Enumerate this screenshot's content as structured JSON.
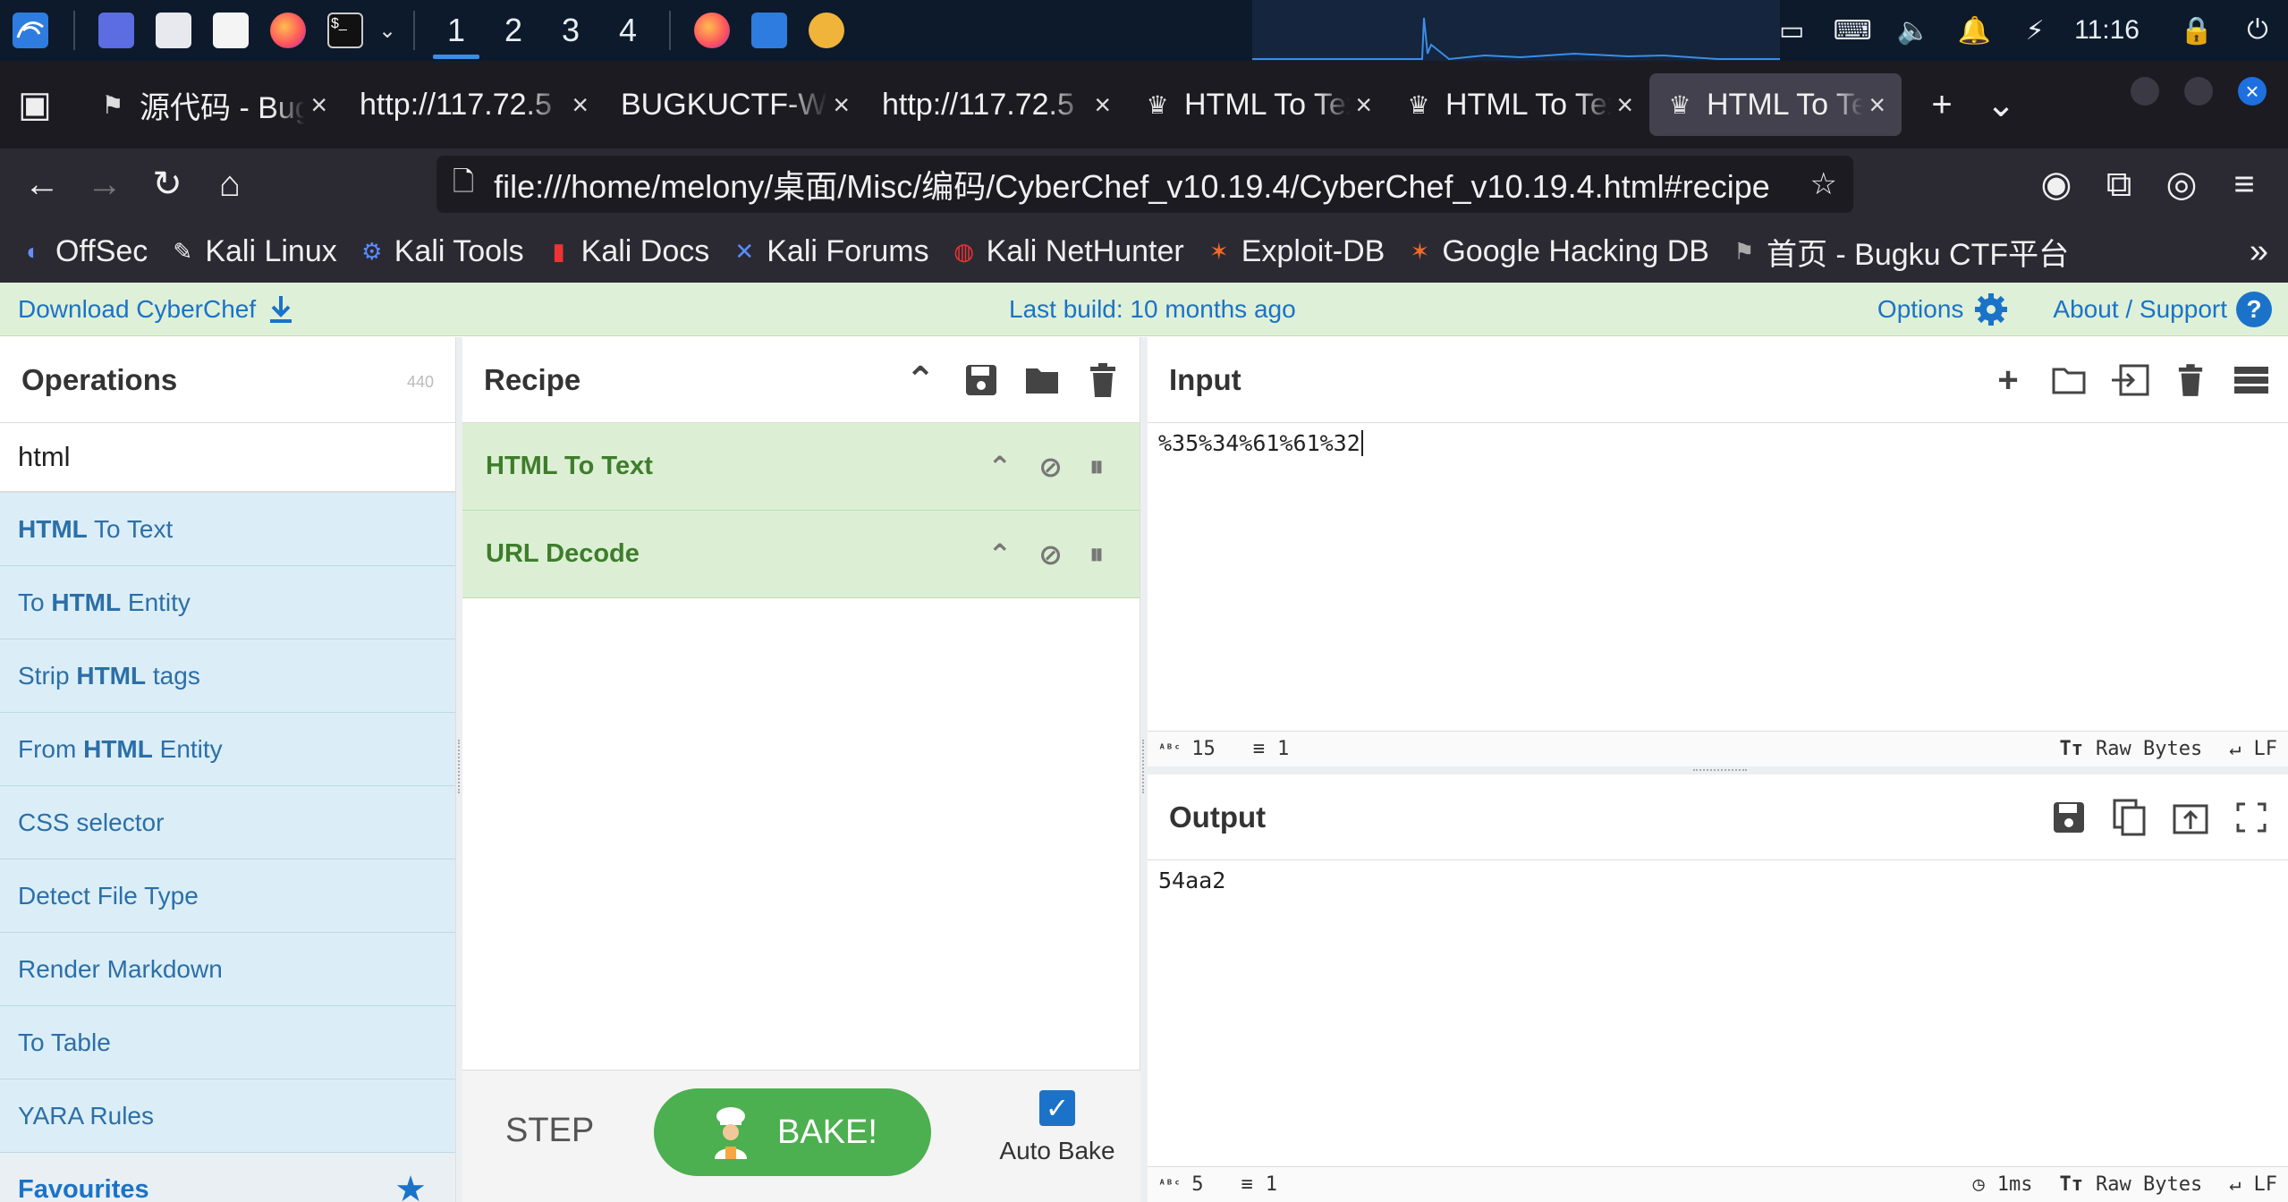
{
  "taskbar": {
    "workspaces": [
      "1",
      "2",
      "3",
      "4"
    ],
    "clock": "11:16"
  },
  "tabs": [
    {
      "title": "源代码 - Bugku",
      "icon": "flag-icon"
    },
    {
      "title": "http://117.72.5",
      "icon": "none"
    },
    {
      "title": "BUGKUCTF-WEB",
      "icon": "none"
    },
    {
      "title": "http://117.72.5",
      "icon": "none"
    },
    {
      "title": "HTML To Text",
      "icon": "chef-hat-icon"
    },
    {
      "title": "HTML To Text",
      "icon": "chef-hat-icon"
    },
    {
      "title": "HTML To Text",
      "icon": "chef-hat-icon",
      "active": true
    }
  ],
  "urlbar": {
    "url": "file:///home/melony/桌面/Misc/编码/CyberChef_v10.19.4/CyberChef_v10.19.4.html#recipe"
  },
  "bookmarks": [
    "OffSec",
    "Kali Linux",
    "Kali Tools",
    "Kali Docs",
    "Kali Forums",
    "Kali NetHunter",
    "Exploit-DB",
    "Google Hacking DB",
    "首页 - Bugku CTF平台"
  ],
  "banner": {
    "download": "Download CyberChef",
    "last_build": "Last build: 10 months ago",
    "options": "Options",
    "about": "About / Support"
  },
  "operations": {
    "title": "Operations",
    "count": "440",
    "search_value": "html",
    "items": [
      {
        "pre": "",
        "bold": "HTML",
        "post": " To Text"
      },
      {
        "pre": "To ",
        "bold": "HTML",
        "post": " Entity"
      },
      {
        "pre": "Strip ",
        "bold": "HTML",
        "post": " tags"
      },
      {
        "pre": "From ",
        "bold": "HTML",
        "post": " Entity"
      },
      {
        "pre": "CSS selector",
        "bold": "",
        "post": ""
      },
      {
        "pre": "Detect File Type",
        "bold": "",
        "post": ""
      },
      {
        "pre": "Render Markdown",
        "bold": "",
        "post": ""
      },
      {
        "pre": "To Table",
        "bold": "",
        "post": ""
      },
      {
        "pre": "YARA Rules",
        "bold": "",
        "post": ""
      }
    ],
    "favourites": "Favourites"
  },
  "recipe": {
    "title": "Recipe",
    "items": [
      "HTML To Text",
      "URL Decode"
    ],
    "step": "STEP",
    "bake": "BAKE!",
    "auto_bake": "Auto Bake"
  },
  "input": {
    "title": "Input",
    "value": "%35%34%61%61%32",
    "length": "15",
    "lines": "1",
    "encoding": "Raw Bytes",
    "eol": "LF"
  },
  "output": {
    "title": "Output",
    "value": "54aa2",
    "length": "5",
    "lines": "1",
    "time": "1ms",
    "encoding": "Raw Bytes",
    "eol": "LF"
  }
}
